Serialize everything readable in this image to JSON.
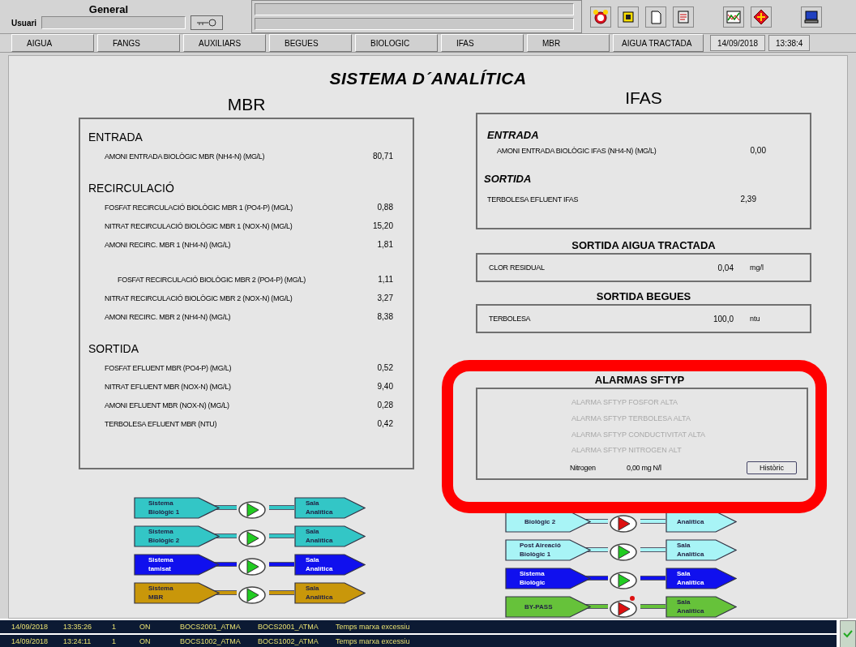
{
  "header": {
    "screen_name": "General",
    "user_label": "Usuari"
  },
  "tabs": [
    "AIGUA",
    "FANGS",
    "AUXILIARS",
    "BEGUES",
    "BIOLOGIC",
    "IFAS",
    "MBR",
    "AIGUA TRACTADA"
  ],
  "date": "14/09/2018",
  "time": "13:38:4",
  "title": "SISTEMA D´ANALÍTICA",
  "mbr": {
    "heading": "MBR",
    "sections": [
      {
        "title": "ENTRADA",
        "groups": [
          [
            {
              "label": "AMONI ENTRADA BIOLÒGIC MBR (NH4-N) (MG/L)",
              "value": "80,71"
            }
          ]
        ]
      },
      {
        "title": "RECIRCULACIÓ",
        "groups": [
          [
            {
              "label": "FOSFAT RECIRCULACIÓ BIOLÒGIC MBR 1 (PO4-P) (MG/L)",
              "value": "0,88"
            },
            {
              "label": "NITRAT RECIRCULACIÓ BIOLÒGIC  MBR 1 (NOX-N) (MG/L)",
              "value": "15,20"
            },
            {
              "label": "AMONI RECIRC. MBR 1 (NH4-N) (MG/L)",
              "value": "1,81"
            }
          ],
          [
            {
              "label": "FOSFAT RECIRCULACIÓ BIOLÒGIC MBR 2 (PO4-P) (MG/L)",
              "value": "1,11",
              "indent": true
            },
            {
              "label": "NITRAT RECIRCULACIÓ BIOLÒGIC MBR 2 (NOX-N) (MG/L)",
              "value": "3,27"
            },
            {
              "label": "AMONI RECIRC. MBR 2 (NH4-N) (MG/L)",
              "value": "8,38"
            }
          ]
        ]
      },
      {
        "title": "SORTIDA",
        "groups": [
          [
            {
              "label": "FOSFAT EFLUENT MBR (PO4-P) (MG/L)",
              "value": "0,52"
            },
            {
              "label": "NITRAT EFLUENT MBR (NOX-N) (MG/L)",
              "value": "9,40"
            },
            {
              "label": "AMONI EFLUENT MBR (NOX-N) (MG/L)",
              "value": "0,28"
            },
            {
              "label": "TERBOLESA EFLUENT MBR (NTU)",
              "value": "0,42"
            }
          ]
        ]
      }
    ]
  },
  "ifas": {
    "heading": "IFAS",
    "sections": [
      {
        "title": "ENTRADA",
        "groups": [
          [
            {
              "label": "AMONI ENTRADA BIOLÒGIC IFAS (NH4-N) (MG/L)",
              "value": "0,00"
            }
          ]
        ]
      },
      {
        "title": "SORTIDA",
        "groups": [
          [
            {
              "label": "TERBOLESA EFLUENT IFAS",
              "value": "2,39"
            }
          ]
        ]
      }
    ]
  },
  "outputs": [
    {
      "title": "SORTIDA AIGUA TRACTADA",
      "label": "CLOR RESIDUAL",
      "value": "0,04",
      "unit": "mg/l"
    },
    {
      "title": "SORTIDA BEGUES",
      "label": "TERBOLESA",
      "value": "100,0",
      "unit": "ntu"
    }
  ],
  "alarms": {
    "title": "ALARMAS SFTYP",
    "items": [
      {
        "text": "ALARMA SFTYP FOSFOR ALTA",
        "active": false
      },
      {
        "text": "ALARMA SFTYP TERBOLESA ALTA",
        "active": false
      },
      {
        "text": "ALARMA SFTYP CONDUCTIVITAT ALTA",
        "active": false
      },
      {
        "text": "ALARMA SFTYP NITROGEN ALT",
        "active": false
      }
    ],
    "reading_label": "Nitrogen",
    "reading": "0,00  mg N/l",
    "button": "Històric"
  },
  "flows_left": [
    {
      "source": [
        "Sistema",
        "Biològic 1"
      ],
      "target": [
        "Sala",
        "Analítica"
      ],
      "color": "#33c6c6",
      "running": true,
      "alarm": false
    },
    {
      "source": [
        "Sistema",
        "Biològic 2"
      ],
      "target": [
        "Sala",
        "Analítica"
      ],
      "color": "#33c6c6",
      "running": true,
      "alarm": false
    },
    {
      "source": [
        "Sistema",
        "tamisat"
      ],
      "target": [
        "Sala",
        "Analítica"
      ],
      "color": "#1010ee",
      "running": true,
      "alarm": false
    },
    {
      "source": [
        "Sistema",
        "MBR"
      ],
      "target": [
        "Sala",
        "Analítica"
      ],
      "color": "#c9970a",
      "running": true,
      "alarm": false
    }
  ],
  "flows_right": [
    {
      "source": [
        "Biològic 2"
      ],
      "target": [
        "Analítica"
      ],
      "color": "#a8f4f6",
      "running": false,
      "alarm": false
    },
    {
      "source": [
        "Post Aireació",
        "Biològic 1"
      ],
      "target": [
        "Sala",
        "Analítica"
      ],
      "color": "#a8f4f6",
      "running": true,
      "alarm": false
    },
    {
      "source": [
        "Sistema",
        "Biològic"
      ],
      "target": [
        "Sala",
        "Analítica"
      ],
      "color": "#1010ee",
      "running": true,
      "alarm": false
    },
    {
      "source": [
        "BY-PASS"
      ],
      "target": [
        "Sala",
        "Analítica"
      ],
      "color": "#66c23a",
      "running": false,
      "alarm": true
    }
  ],
  "event_log": [
    {
      "date": "14/09/2018",
      "time": "13:35:26",
      "count": "1",
      "state": "ON",
      "tag": "BOCS2001_ATMA",
      "tag2": "BOCS2001_ATMA",
      "message": "Temps marxa excessiu"
    },
    {
      "date": "14/09/2018",
      "time": "13:24:11",
      "count": "1",
      "state": "ON",
      "tag": "BOCS1002_ATMA",
      "tag2": "BOCS1002_ATMA",
      "message": "Temps marxa excessiu"
    }
  ]
}
